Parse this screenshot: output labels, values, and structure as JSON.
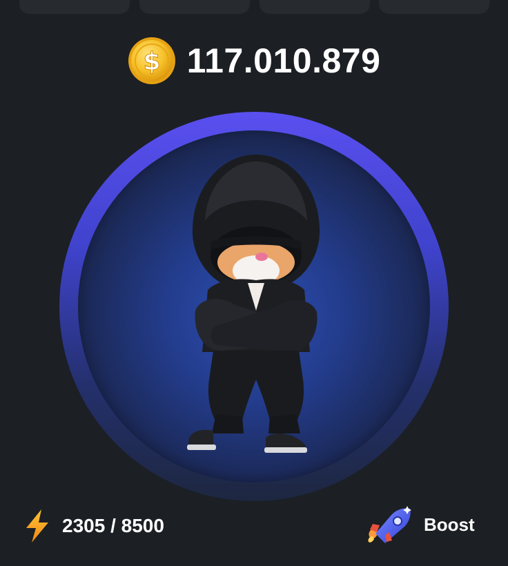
{
  "balance": {
    "value": "117.010.879",
    "icon": "coin-icon"
  },
  "energy": {
    "current": 2305,
    "max": 8500,
    "label": "2305 / 8500",
    "icon": "lightning-icon"
  },
  "boost": {
    "label": "Boost",
    "icon": "rocket-icon"
  },
  "tap_area": {
    "character": "hooded-hamster"
  },
  "colors": {
    "background": "#1c1f24",
    "ring": "#5a4ff0",
    "inner": "#2d4fb3",
    "coin": "#f5b81c",
    "bolt": "#f7a21b"
  }
}
